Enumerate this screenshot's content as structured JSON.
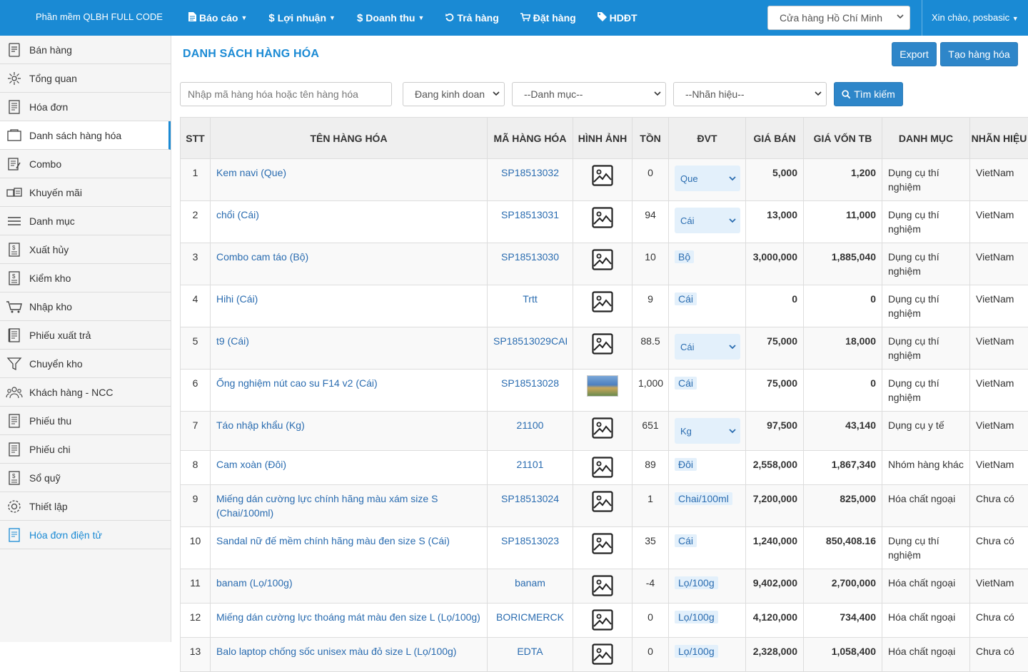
{
  "brand": "Phần mềm QLBH FULL CODE",
  "nav": [
    {
      "label": "Báo cáo",
      "icon": "file-icon",
      "caret": true
    },
    {
      "label": "Lợi nhuận",
      "icon": "dollar-icon",
      "caret": true
    },
    {
      "label": "Doanh thu",
      "icon": "dollar-icon",
      "caret": true
    },
    {
      "label": "Trả hàng",
      "icon": "undo-icon",
      "caret": false
    },
    {
      "label": "Đặt hàng",
      "icon": "cart-icon",
      "caret": false
    },
    {
      "label": "HDĐT",
      "icon": "tag-icon",
      "caret": false
    }
  ],
  "store_select": "Cửa hàng Hồ Chí Minh",
  "greeting": "Xin chào, posbasic",
  "sidebar": [
    {
      "label": "Bán hàng",
      "icon": "sales-icon"
    },
    {
      "label": "Tổng quan",
      "icon": "overview-icon"
    },
    {
      "label": "Hóa đơn",
      "icon": "invoice-icon"
    },
    {
      "label": "Danh sách hàng hóa",
      "icon": "product-list-icon",
      "active": true
    },
    {
      "label": "Combo",
      "icon": "combo-icon"
    },
    {
      "label": "Khuyến mãi",
      "icon": "promotion-icon"
    },
    {
      "label": "Danh mục",
      "icon": "category-icon"
    },
    {
      "label": "Xuất hủy",
      "icon": "dispose-icon"
    },
    {
      "label": "Kiểm kho",
      "icon": "stock-check-icon"
    },
    {
      "label": "Nhập kho",
      "icon": "stock-in-icon"
    },
    {
      "label": "Phiếu xuất trả",
      "icon": "return-slip-icon"
    },
    {
      "label": "Chuyển kho",
      "icon": "transfer-icon"
    },
    {
      "label": "Khách hàng - NCC",
      "icon": "customers-icon"
    },
    {
      "label": "Phiếu thu",
      "icon": "receipt-icon"
    },
    {
      "label": "Phiếu chi",
      "icon": "payment-icon"
    },
    {
      "label": "Sổ quỹ",
      "icon": "cashbook-icon"
    },
    {
      "label": "Thiết lập",
      "icon": "gear-icon"
    },
    {
      "label": "Hóa đơn điện tử",
      "icon": "e-invoice-icon",
      "highlight": true
    }
  ],
  "page_title": "DANH SÁCH HÀNG HÓA",
  "buttons": {
    "export": "Export",
    "create": "Tạo hàng hóa",
    "search": "Tìm kiếm"
  },
  "filters": {
    "search_placeholder": "Nhập mã hàng hóa hoặc tên hàng hóa",
    "status": "Đang kinh doan",
    "category": "--Danh mục--",
    "brand": "--Nhãn hiệu--"
  },
  "table": {
    "headers": {
      "stt": "STT",
      "name": "TÊN HÀNG HÓA",
      "code": "MÃ HÀNG HÓA",
      "image": "HÌNH ẢNH",
      "stock": "TỒN",
      "unit": "ĐVT",
      "price": "GIÁ BÁN",
      "cost": "GIÁ VỐN TB",
      "category": "DANH MỤC",
      "brand": "NHÃN HIỆU"
    },
    "rows": [
      {
        "stt": "1",
        "name": "Kem navi (Que)",
        "code": "SP18513032",
        "image": "placeholder",
        "stock": "0",
        "unit": "Que",
        "unit_type": "select",
        "price": "5,000",
        "cost": "1,200",
        "category": "Dụng cụ thí nghiệm",
        "brand": "VietNam"
      },
      {
        "stt": "2",
        "name": "chổi (Cái)",
        "code": "SP18513031",
        "image": "placeholder",
        "stock": "94",
        "unit": "Cái",
        "unit_type": "select",
        "price": "13,000",
        "cost": "11,000",
        "category": "Dụng cụ thí nghiệm",
        "brand": "VietNam"
      },
      {
        "stt": "3",
        "name": "Combo cam táo (Bộ)",
        "code": "SP18513030",
        "image": "placeholder",
        "stock": "10",
        "unit": "Bộ",
        "unit_type": "tag",
        "price": "3,000,000",
        "cost": "1,885,040",
        "category": "Dụng cụ thí nghiệm",
        "brand": "VietNam"
      },
      {
        "stt": "4",
        "name": "Hihi (Cái)",
        "code": "Trtt",
        "image": "placeholder",
        "stock": "9",
        "unit": "Cái",
        "unit_type": "tag",
        "price": "0",
        "cost": "0",
        "category": "Dụng cụ thí nghiệm",
        "brand": "VietNam"
      },
      {
        "stt": "5",
        "name": "t9 (Cái)",
        "code": "SP18513029CAI",
        "image": "placeholder",
        "stock": "88.5",
        "unit": "Cái",
        "unit_type": "select",
        "price": "75,000",
        "cost": "18,000",
        "category": "Dụng cụ thí nghiệm",
        "brand": "VietNam"
      },
      {
        "stt": "6",
        "name": "Ống nghiệm nút cao su F14 v2 (Cái)",
        "code": "SP18513028",
        "image": "photo",
        "stock": "1,000",
        "unit": "Cái",
        "unit_type": "tag",
        "price": "75,000",
        "cost": "0",
        "category": "Dụng cụ thí nghiệm",
        "brand": "VietNam"
      },
      {
        "stt": "7",
        "name": "Táo nhập khẩu (Kg)",
        "code": "21100",
        "image": "placeholder",
        "stock": "651",
        "unit": "Kg",
        "unit_type": "select",
        "price": "97,500",
        "cost": "43,140",
        "category": "Dụng cụ y tế",
        "brand": "VietNam"
      },
      {
        "stt": "8",
        "name": "Cam xoàn (Đôi)",
        "code": "21101",
        "image": "placeholder",
        "stock": "89",
        "unit": "Đôi",
        "unit_type": "tag",
        "price": "2,558,000",
        "cost": "1,867,340",
        "category": "Nhóm hàng khác",
        "brand": "VietNam"
      },
      {
        "stt": "9",
        "name": "Miếng dán cường lực chính hãng màu xám size S (Chai/100ml)",
        "code": "SP18513024",
        "image": "placeholder",
        "stock": "1",
        "unit": "Chai/100ml",
        "unit_type": "tag",
        "price": "7,200,000",
        "cost": "825,000",
        "category": "Hóa chất ngoại",
        "brand": "Chưa có"
      },
      {
        "stt": "10",
        "name": "Sandal nữ đế mềm chính hãng màu đen size S (Cái)",
        "code": "SP18513023",
        "image": "placeholder",
        "stock": "35",
        "unit": "Cái",
        "unit_type": "tag",
        "price": "1,240,000",
        "cost": "850,408.16",
        "category": "Dụng cụ thí nghiệm",
        "brand": "Chưa có"
      },
      {
        "stt": "11",
        "name": "banam (Lọ/100g)",
        "code": "banam",
        "image": "placeholder",
        "stock": "-4",
        "unit": "Lọ/100g",
        "unit_type": "tag",
        "price": "9,402,000",
        "cost": "2,700,000",
        "category": "Hóa chất ngoại",
        "brand": "VietNam"
      },
      {
        "stt": "12",
        "name": "Miếng dán cường lực thoáng mát màu đen size L (Lọ/100g)",
        "code": "BORICMERCK",
        "image": "placeholder",
        "stock": "0",
        "unit": "Lọ/100g",
        "unit_type": "tag",
        "price": "4,120,000",
        "cost": "734,400",
        "category": "Hóa chất ngoại",
        "brand": "Chưa có"
      },
      {
        "stt": "13",
        "name": "Balo laptop chống sốc unisex màu đỏ size L (Lọ/100g)",
        "code": "EDTA",
        "image": "placeholder",
        "stock": "0",
        "unit": "Lọ/100g",
        "unit_type": "tag",
        "price": "2,328,000",
        "cost": "1,058,400",
        "category": "Hóa chất ngoại",
        "brand": "Chưa có"
      }
    ]
  },
  "colors": {
    "primary": "#1a8ad4",
    "button": "#2e86c9",
    "link": "#2a6cb0",
    "unit_bg": "#e3f0fb"
  }
}
